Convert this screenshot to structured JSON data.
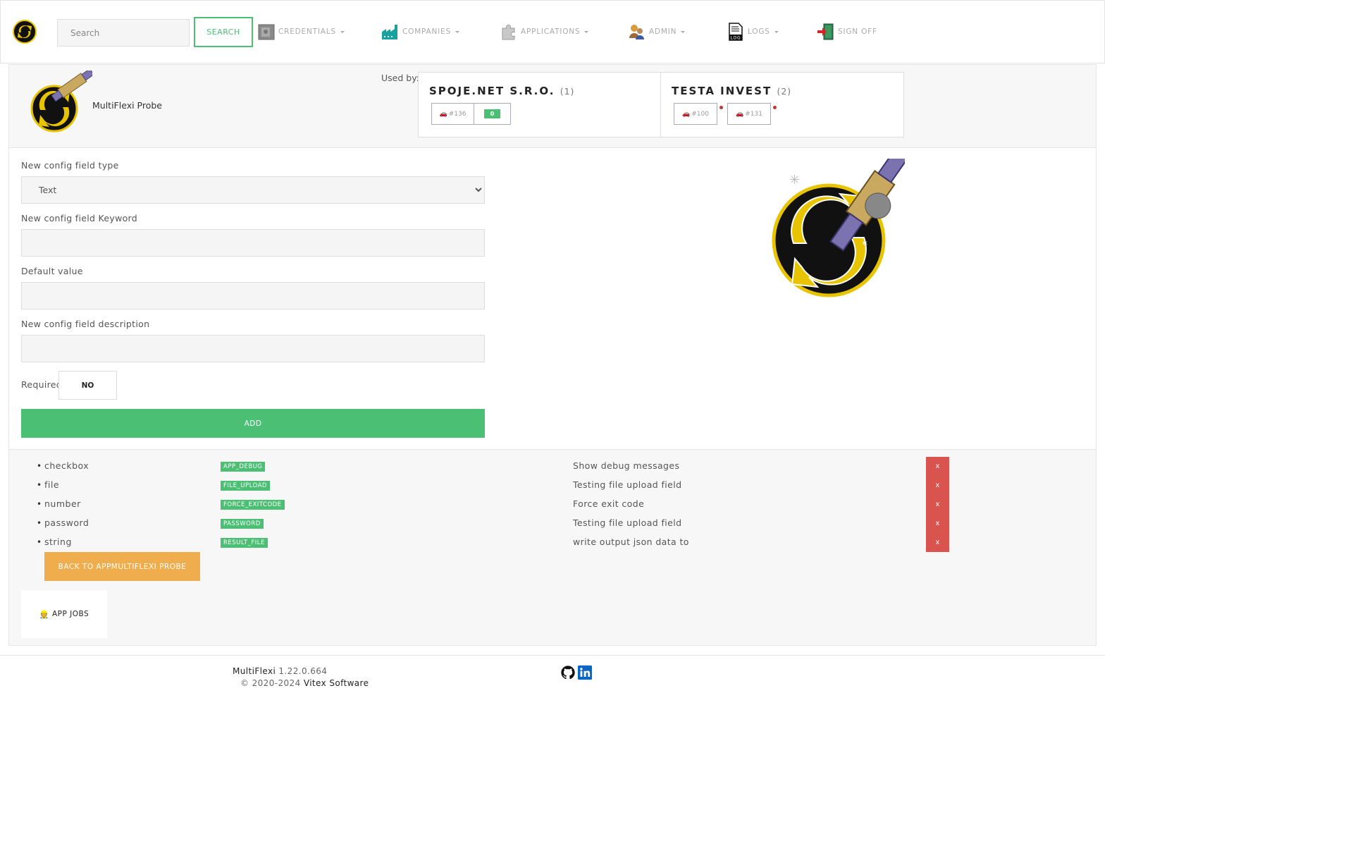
{
  "navbar": {
    "search_placeholder": "Search",
    "search_button": "SEARCH",
    "items": [
      {
        "label": "CREDENTIALS",
        "icon": "safe-icon"
      },
      {
        "label": "COMPANIES",
        "icon": "factory-icon"
      },
      {
        "label": "APPLICATIONS",
        "icon": "puzzle-icon"
      },
      {
        "label": "ADMIN",
        "icon": "users-icon"
      },
      {
        "label": "LOGS",
        "icon": "log-file-icon"
      },
      {
        "label": "SIGN OFF",
        "icon": "exit-door-icon"
      }
    ]
  },
  "app": {
    "name": "MultiFlexi Probe",
    "used_by_label": "Used by:",
    "companies": [
      {
        "name": "SPOJE.NET S.R.O.",
        "count": "(1)",
        "jobs": [
          "#136"
        ],
        "chip": "0"
      },
      {
        "name": "TESTA INVEST",
        "count": "(2)",
        "jobs": [
          "#100",
          "#131"
        ]
      }
    ]
  },
  "form": {
    "type_label": "New config field type",
    "type_value": "Text",
    "keyword_label": "New config field Keyword",
    "default_label": "Default value",
    "description_label": "New config field description",
    "required_label": "Required",
    "required_value": "NO",
    "add_button": "ADD"
  },
  "fields": [
    {
      "type": "checkbox",
      "keyword": "APP_DEBUG",
      "description": "Show debug messages",
      "delete": "x"
    },
    {
      "type": "file",
      "keyword": "FILE_UPLOAD",
      "description": "Testing file upload field",
      "delete": "x"
    },
    {
      "type": "number",
      "keyword": "FORCE_EXITCODE",
      "description": "Force exit code",
      "delete": "x"
    },
    {
      "type": "password",
      "keyword": "PASSWORD",
      "description": "Testing file upload field",
      "delete": "x"
    },
    {
      "type": "string",
      "keyword": "RESULT_FILE",
      "description": "write output json data to",
      "delete": "x"
    }
  ],
  "actions": {
    "back_button": "BACK TO APPMULTIFLEXI PROBE",
    "app_jobs": "APP JOBS"
  },
  "footer": {
    "product": "MultiFlexi",
    "version": "1.22.0.664",
    "copyright": "© 2020-2024",
    "vendor": "Vitex Software"
  },
  "colors": {
    "success": "#4bbf73",
    "warning": "#f0ad4e",
    "danger": "#d9534f"
  }
}
